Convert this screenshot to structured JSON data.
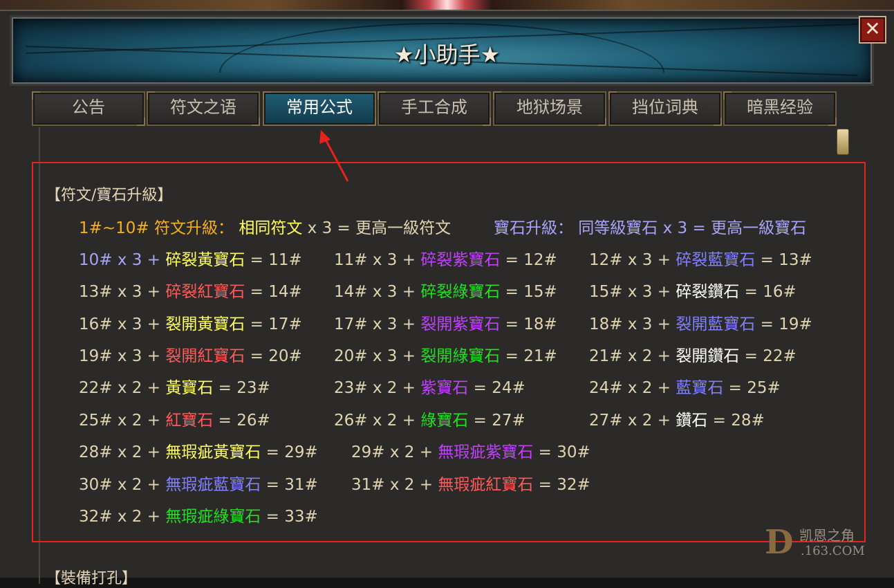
{
  "window": {
    "title": "★小助手★",
    "close_label": "✕"
  },
  "tabs": [
    {
      "label": "公告"
    },
    {
      "label": "符文之语"
    },
    {
      "label": "常用公式"
    },
    {
      "label": "手工合成"
    },
    {
      "label": "地狱场景"
    },
    {
      "label": "挡位词典"
    },
    {
      "label": "暗黑经验"
    }
  ],
  "active_tab": "常用公式",
  "section1": {
    "title": "【符文/寶石升級】",
    "rune_upgrade": {
      "label": "1#~10# 符文升級：",
      "formula": "相同符文",
      "rest": " x 3 = 更高一級符文"
    },
    "gem_upgrade": {
      "text": "寶石升級： 同等級寶石 x 3 = 更高一級寶石"
    },
    "rows": [
      [
        {
          "pre": "10# x 3 + ",
          "item": "碎裂黃寶石",
          "post": " = 11#"
        },
        {
          "pre": "11# x 3 + ",
          "item": "碎裂紫寶石",
          "post": " = 12#"
        },
        {
          "pre": "12# x 3 + ",
          "item": "碎裂藍寶石",
          "post": " = 13#"
        }
      ],
      [
        {
          "pre": "13# x 3 + ",
          "item": "碎裂紅寶石",
          "post": " = 14#"
        },
        {
          "pre": "14# x 3 + ",
          "item": "碎裂綠寶石",
          "post": " = 15#"
        },
        {
          "pre": "15# x 3 + ",
          "item": "碎裂鑽石",
          "post": " = 16#"
        }
      ],
      [
        {
          "pre": "16# x 3 + ",
          "item": "裂開黃寶石",
          "post": " = 17#"
        },
        {
          "pre": "17# x 3 + ",
          "item": "裂開紫寶石",
          "post": " = 18#"
        },
        {
          "pre": "18# x 3 + ",
          "item": "裂開藍寶石",
          "post": " = 19#"
        }
      ],
      [
        {
          "pre": "19# x 3 + ",
          "item": "裂開紅寶石",
          "post": " = 20#"
        },
        {
          "pre": "20# x 3 + ",
          "item": "裂開綠寶石",
          "post": " = 21#"
        },
        {
          "pre": "21# x 2 + ",
          "item": "裂開鑽石",
          "post": " = 22#"
        }
      ],
      [
        {
          "pre": "22# x 2 + ",
          "item": "黃寶石",
          "post": " = 23#"
        },
        {
          "pre": "23# x 2 + ",
          "item": "紫寶石",
          "post": " = 24#"
        },
        {
          "pre": "24# x 2 + ",
          "item": "藍寶石",
          "post": " = 25#"
        }
      ],
      [
        {
          "pre": "25# x 2 + ",
          "item": "紅寶石",
          "post": " = 26#"
        },
        {
          "pre": "26# x 2 + ",
          "item": "綠寶石",
          "post": " = 27#"
        },
        {
          "pre": "27# x 2 + ",
          "item": "鑽石",
          "post": " = 28#"
        }
      ],
      [
        {
          "pre": "28# x 2 + ",
          "item": "無瑕疵黃寶石",
          "post": " = 29#"
        },
        {
          "pre": "29# x 2 + ",
          "item": "無瑕疵紫寶石",
          "post": " = 30#"
        }
      ],
      [
        {
          "pre": "30# x 2 + ",
          "item": "無瑕疵藍寶石",
          "post": " = 31#"
        },
        {
          "pre": "31# x 2 + ",
          "item": "無瑕疵紅寶石",
          "post": " = 32#"
        }
      ],
      [
        {
          "pre": "32# x 2 + ",
          "item": "無瑕疵綠寶石",
          "post": " = 33#"
        }
      ]
    ]
  },
  "section2": {
    "title": "【裝備打孔】"
  },
  "watermark": {
    "logo": "D",
    "line1": "凯恩之角",
    "line2": ".163.COM"
  },
  "colors": {
    "accent_red": "#e8231d",
    "gold": "#f4b020",
    "lavender": "#a8a4f8"
  }
}
